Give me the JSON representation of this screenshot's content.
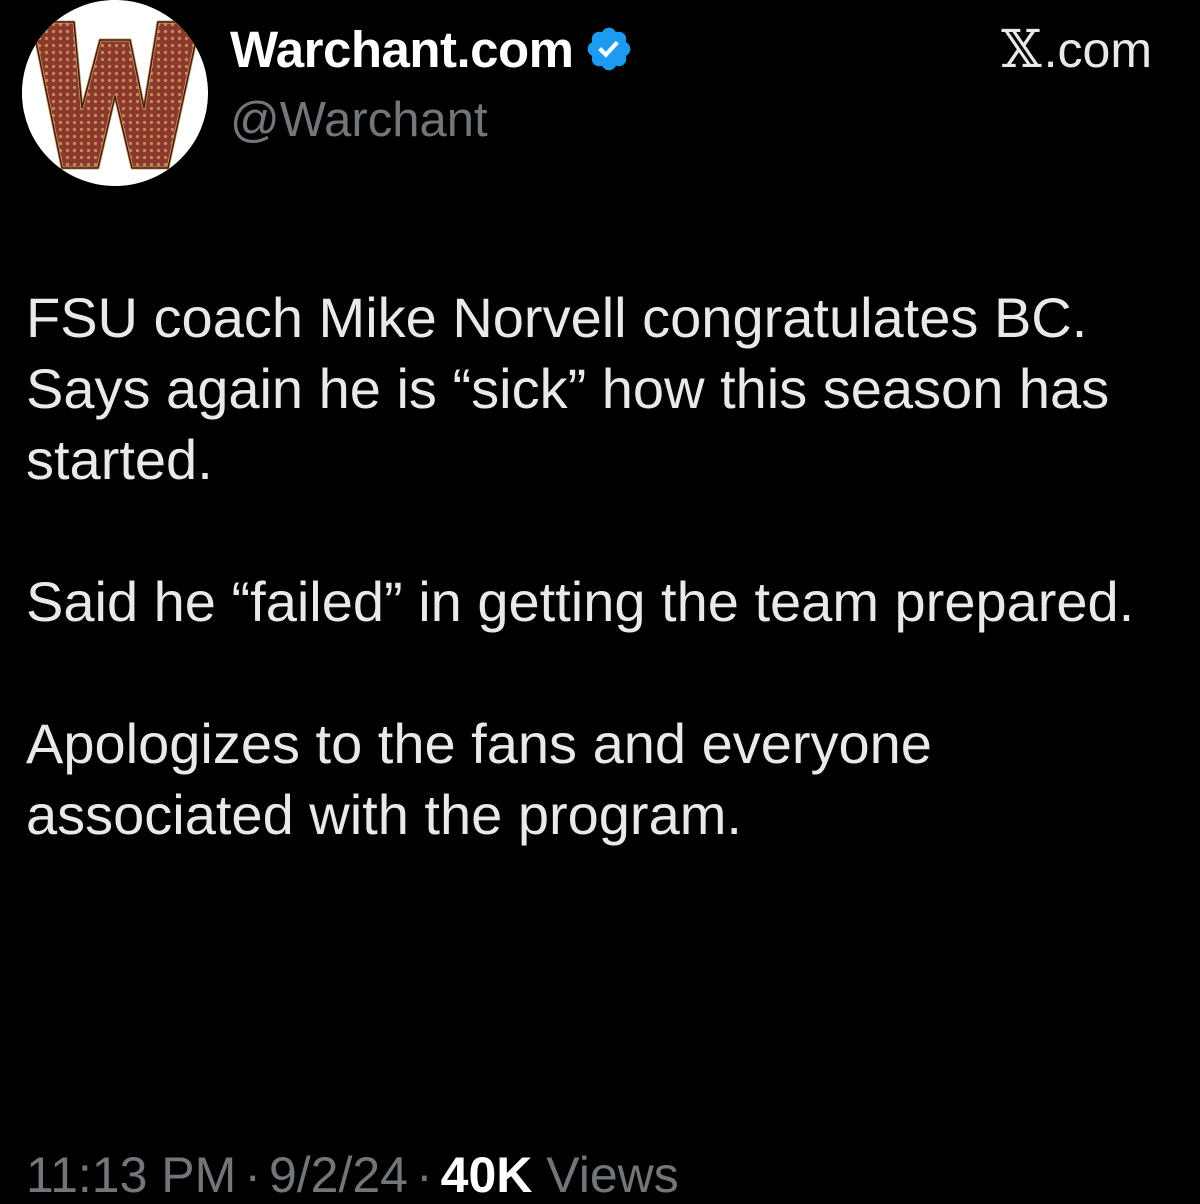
{
  "account": {
    "display_name": "Warchant.com",
    "handle": "@Warchant",
    "verified_icon": "verified-badge-icon",
    "avatar_logo_letter": "W"
  },
  "source": {
    "prefix": "𝕏",
    "suffix": ".com"
  },
  "tweet": {
    "paragraphs": [
      "FSU coach Mike Norvell congratulates BC. Says again he is “sick” how this season has started.",
      "Said he “failed” in getting the team prepared.",
      "Apologizes to the fans and everyone associated with the program."
    ]
  },
  "meta": {
    "time": "11:13 PM",
    "separator": "·",
    "date": "9/2/24",
    "views_count": "40K",
    "views_label": "Views"
  },
  "colors": {
    "background": "#000000",
    "text": "#e7e9ea",
    "secondary_text": "#71767b",
    "verified_blue": "#1d9bf0",
    "logo_maroon": "#7a2a24",
    "logo_gold": "#c9a46a"
  }
}
